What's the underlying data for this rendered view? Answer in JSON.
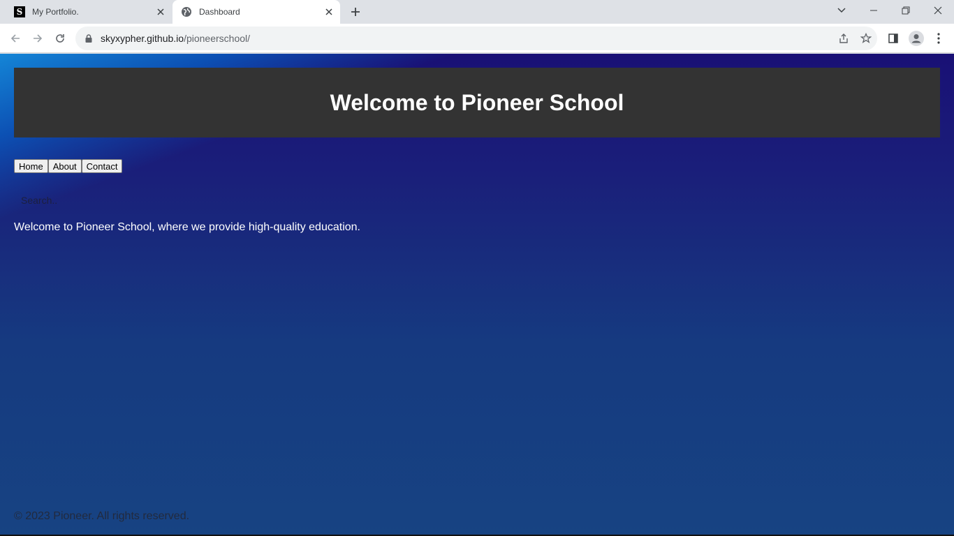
{
  "browser": {
    "tabs": [
      {
        "title": "My Portfolio.",
        "favicon": "S",
        "active": false
      },
      {
        "title": "Dashboard",
        "favicon": "globe-icon",
        "active": true
      }
    ],
    "url_host": "skyxypher.github.io",
    "url_path": "/pioneerschool/"
  },
  "page": {
    "header_title": "Welcome to Pioneer School",
    "nav": [
      "Home",
      "About",
      "Contact"
    ],
    "search_placeholder": "Search..",
    "intro_text": "Welcome to Pioneer School, where we provide high-quality education.",
    "footer_text": "© 2023 Pioneer. All rights reserved.",
    "colors": {
      "header_bg": "#333333",
      "page_bg_top": "#191075",
      "page_bg_bottom": "#174382"
    }
  }
}
